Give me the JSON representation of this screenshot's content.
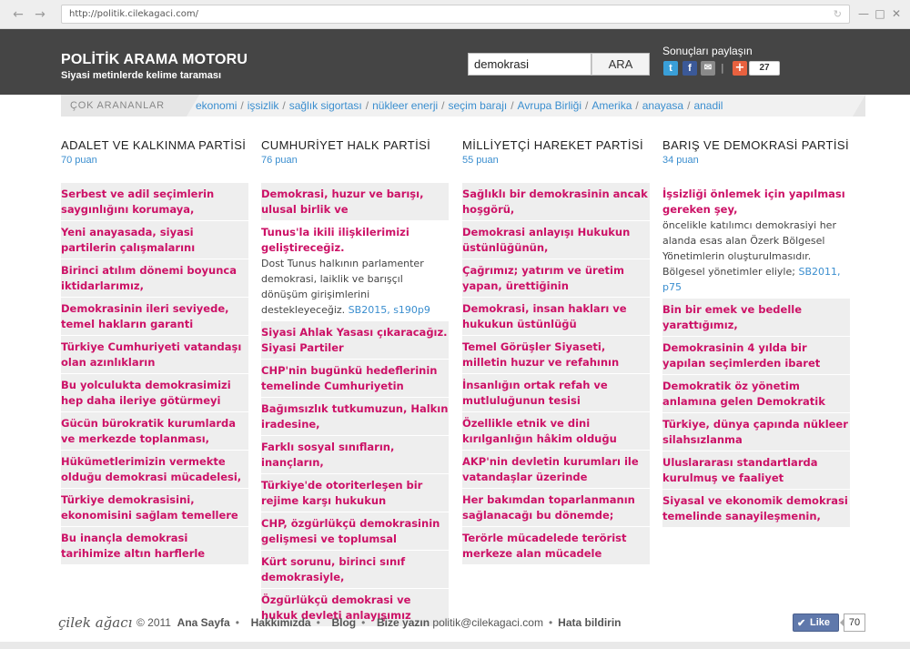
{
  "browser": {
    "url": "http://politik.cilekagaci.com/"
  },
  "header": {
    "title": "POLİTİK ARAMA MOTORU",
    "subtitle": "Siyasi metinlerde kelime taraması",
    "search_value": "demokrasi",
    "search_button": "ARA",
    "share_label": "Sonuçları paylaşın",
    "share_count": "27"
  },
  "popular": {
    "label": "ÇOK ARANANLAR",
    "links": [
      "ekonomi",
      "işsizlik",
      "sağlık sigortası",
      "nükleer enerji",
      "seçim barajı",
      "Avrupa Birliği",
      "Amerika",
      "anayasa",
      "anadil"
    ]
  },
  "columns": [
    {
      "party": "ADALET VE KALKINMA PARTİSİ",
      "score": "70 puan",
      "results": [
        {
          "title": "Serbest ve adil seçimlerin saygınlığını korumaya,"
        },
        {
          "title": "Yeni anayasada, siyasi partilerin çalışmalarını"
        },
        {
          "title": "Birinci atılım dönemi boyunca iktidarlarımız,"
        },
        {
          "title": "Demokrasinin ileri seviyede, temel hakların garanti"
        },
        {
          "title": "Türkiye Cumhuriyeti vatandaşı olan azınlıkların"
        },
        {
          "title": "Bu yolculukta demokrasimizi hep daha ileriye götürmeyi"
        },
        {
          "title": "Gücün bürokratik kurumlarda ve merkezde toplanması,"
        },
        {
          "title": "Hükümetlerimizin vermekte olduğu demokrasi mücadelesi,"
        },
        {
          "title": "Türkiye demokrasisini, ekonomisini sağlam temellere"
        },
        {
          "title": "Bu inançla demokrasi tarihimize altın harflerle"
        }
      ]
    },
    {
      "party": "CUMHURİYET HALK PARTİSİ",
      "score": "76 puan",
      "results": [
        {
          "title": "Demokrasi, huzur ve barışı, ulusal birlik ve"
        },
        {
          "title": "Tunus'la ikili ilişkilerimizi geliştireceğiz.",
          "desc": "Dost Tunus halkının parlamenter demokrasi, laiklik ve barışçıl dönüşüm girişimlerini destekleyeceğiz.",
          "ref": "SB2015, s190p9",
          "plain": true
        },
        {
          "title": "Siyasi Ahlak Yasası çıkaracağız. Siyasi Partiler"
        },
        {
          "title": "CHP'nin bugünkü hedeflerinin temelinde Cumhuriyetin"
        },
        {
          "title": "Bağımsızlık tutkumuzun, Halkın iradesine,"
        },
        {
          "title": "Farklı sosyal sınıfların, inançların,"
        },
        {
          "title": "Türkiye'de otoriterleşen bir rejime karşı hukukun"
        },
        {
          "title": "CHP, özgürlükçü demokrasinin gelişmesi ve toplumsal"
        },
        {
          "title": "Kürt sorunu, birinci sınıf demokrasiyle,"
        },
        {
          "title": "Özgürlükçü demokrasi ve hukuk devleti anlayışımız"
        }
      ]
    },
    {
      "party": "MİLLİYETÇİ HAREKET PARTİSİ",
      "score": "55 puan",
      "results": [
        {
          "title": "Sağlıklı bir demokrasinin ancak hoşgörü,"
        },
        {
          "title": "Demokrasi anlayışı Hukukun üstünlüğünün,"
        },
        {
          "title": "Çağrımız; yatırım ve üretim yapan, ürettiğinin"
        },
        {
          "title": "Demokrasi, insan hakları ve hukukun üstünlüğü"
        },
        {
          "title": "Temel Görüşler Siyaseti, milletin huzur ve refahının"
        },
        {
          "title": "İnsanlığın ortak refah ve mutluluğunun tesisi"
        },
        {
          "title": "Özellikle etnik ve dini kırılganlığın hâkim olduğu"
        },
        {
          "title": "AKP'nin devletin kurumları ile vatandaşlar üzerinde"
        },
        {
          "title": "Her bakımdan toparlanmanın sağlanacağı bu dönemde;"
        },
        {
          "title": "Terörle mücadelede terörist merkeze alan mücadele"
        }
      ]
    },
    {
      "party": "BARIŞ VE DEMOKRASİ PARTİSİ",
      "score": "34 puan",
      "results": [
        {
          "title": "İşsizliği önlemek için yapılması gereken şey,",
          "desc": "öncelikle katılımcı demokrasiyi her alanda esas alan Özerk Bölgesel Yönetimlerin oluşturulmasıdır. Bölgesel yönetimler eliyle;",
          "ref": "SB2011, p75",
          "plain": true
        },
        {
          "title": "Bin bir emek ve bedelle yarattığımız,"
        },
        {
          "title": "Demokrasinin 4 yılda bir yapılan seçimlerden ibaret"
        },
        {
          "title": "Demokratik öz yönetim anlamına gelen Demokratik"
        },
        {
          "title": "Türkiye, dünya çapında nükleer silahsızlanma"
        },
        {
          "title": "Uluslararası standartlarda kurulmuş ve faaliyet"
        },
        {
          "title": "Siyasal ve ekonomik demokrasi temelinde sanayileşmenin,"
        }
      ]
    }
  ],
  "footer": {
    "logo": "çilek ağacı",
    "copyright": "© 2011",
    "links": [
      "Ana Sayfa",
      "Hakkımızda",
      "Blog",
      "Bize yazın"
    ],
    "email": "politik@cilekagaci.com",
    "report": "Hata bildirin",
    "like_label": "Like",
    "like_count": "70"
  },
  "colors": {
    "header_bg": "#454545",
    "result_title": "#cc1166",
    "link_blue": "#3a8ecf",
    "result_bg": "#eeeeee"
  }
}
